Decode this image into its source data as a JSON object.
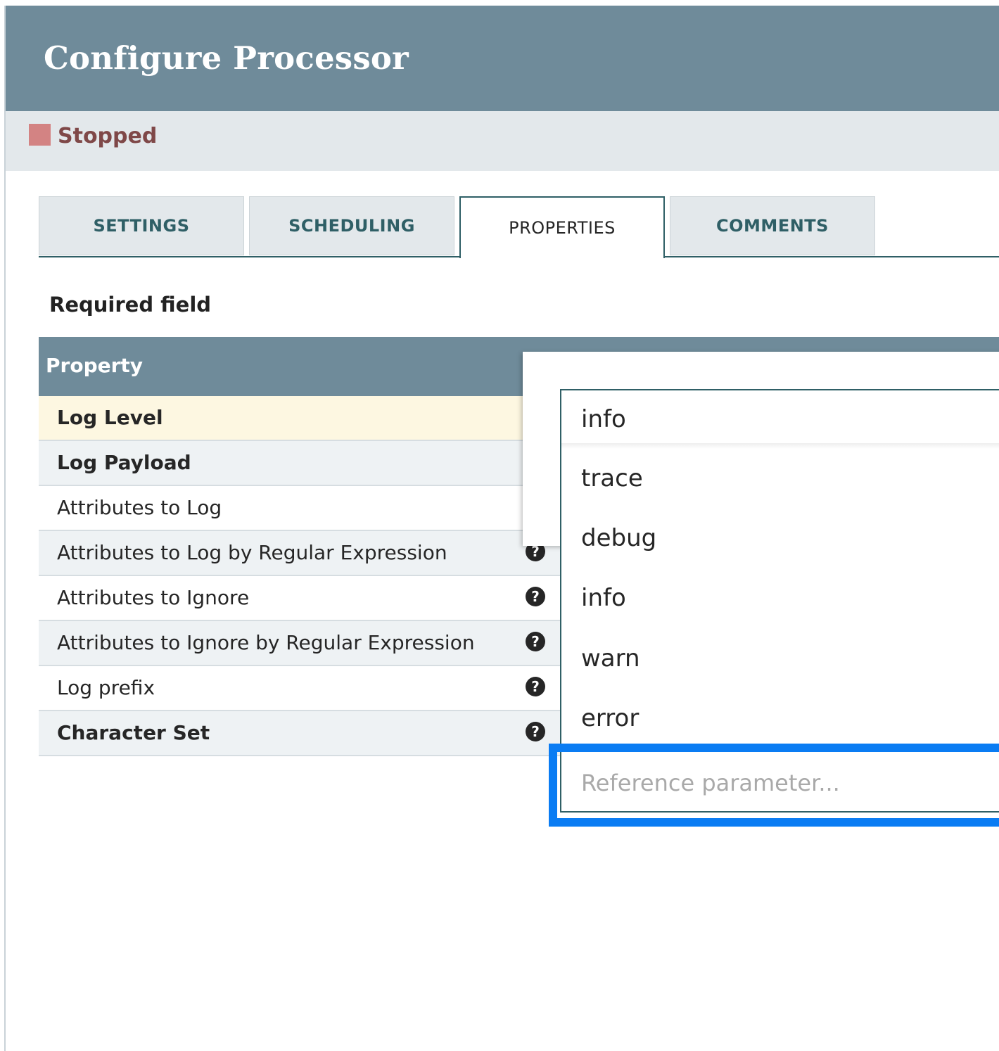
{
  "dialog": {
    "title": "Configure Processor",
    "status": "Stopped"
  },
  "tabs": [
    {
      "label": "SETTINGS",
      "active": false
    },
    {
      "label": "SCHEDULING",
      "active": false
    },
    {
      "label": "PROPERTIES",
      "active": true
    },
    {
      "label": "COMMENTS",
      "active": false
    }
  ],
  "properties": {
    "required_label": "Required field",
    "column_header": "Property",
    "rows": [
      {
        "name": "Log Level",
        "required": true
      },
      {
        "name": "Log Payload",
        "required": true
      },
      {
        "name": "Attributes to Log",
        "required": false
      },
      {
        "name": "Attributes to Log by Regular Expression",
        "required": false
      },
      {
        "name": "Attributes to Ignore",
        "required": false
      },
      {
        "name": "Attributes to Ignore by Regular Expression",
        "required": false
      },
      {
        "name": "Log prefix",
        "required": false
      },
      {
        "name": "Character Set",
        "required": true
      }
    ]
  },
  "combobox": {
    "selected_value": "info",
    "options": [
      "trace",
      "debug",
      "info",
      "warn",
      "error"
    ],
    "parameter_placeholder": "Reference parameter..."
  },
  "colors": {
    "header": "#6f8b9a",
    "status_stopped": "#d38383",
    "tab_accent": "#2f5f66",
    "focus": "#0a7cf3",
    "selected_row": "#fdf7e1"
  },
  "icons": {
    "status": "stopped-square-icon",
    "help": "question-circle-icon"
  }
}
